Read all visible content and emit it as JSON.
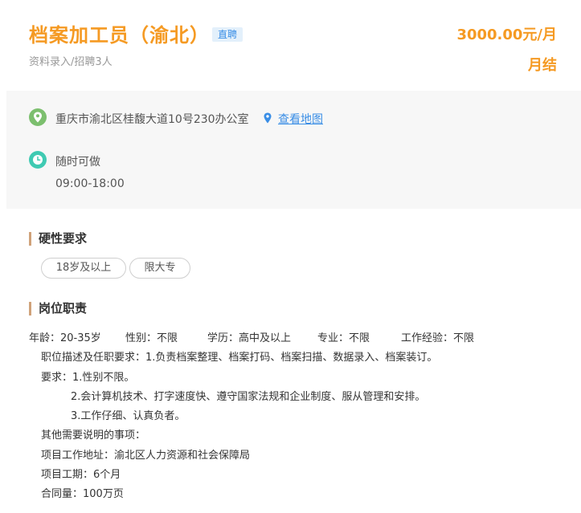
{
  "header": {
    "title": "档案加工员（渝北）",
    "badge": "直聘",
    "subtitle": "资料录入/招聘3人",
    "salary_line1": "3000.00元/月",
    "salary_line2": "月结"
  },
  "info": {
    "address": "重庆市渝北区桂馥大道10号230办公室",
    "map_link": "查看地图",
    "schedule": "随时可做",
    "hours": "09:00-18:00"
  },
  "requirements": {
    "title": "硬性要求",
    "tags": [
      "18岁及以上",
      "限大专"
    ]
  },
  "duties": {
    "title": "岗位职责",
    "meta": {
      "age": "年龄：20-35岁",
      "gender": "性别：不限",
      "education": "学历：高中及以上",
      "major": "专业：不限",
      "experience": "工作经验：不限"
    },
    "lines": [
      "职位描述及任职要求：1.负责档案整理、档案打码、档案扫描、数据录入、档案装订。",
      "要求：1.性别不限。",
      "2.会计算机技术、打字速度快、遵守国家法规和企业制度、服从管理和安排。",
      "3.工作仔细、认真负者。",
      "其他需要说明的事项：",
      "项目工作地址：渝北区人力资源和社会保障局",
      "项目工期：6个月",
      "合同量：100万页"
    ]
  },
  "colors": {
    "accent": "#f59a23",
    "link": "#3a8ee6",
    "section_bar": "#d0a27a",
    "location_icon": "#7cbf6e",
    "clock_icon": "#3fcab2"
  },
  "icons": [
    "location-icon",
    "map-pin-icon",
    "clock-icon"
  ]
}
